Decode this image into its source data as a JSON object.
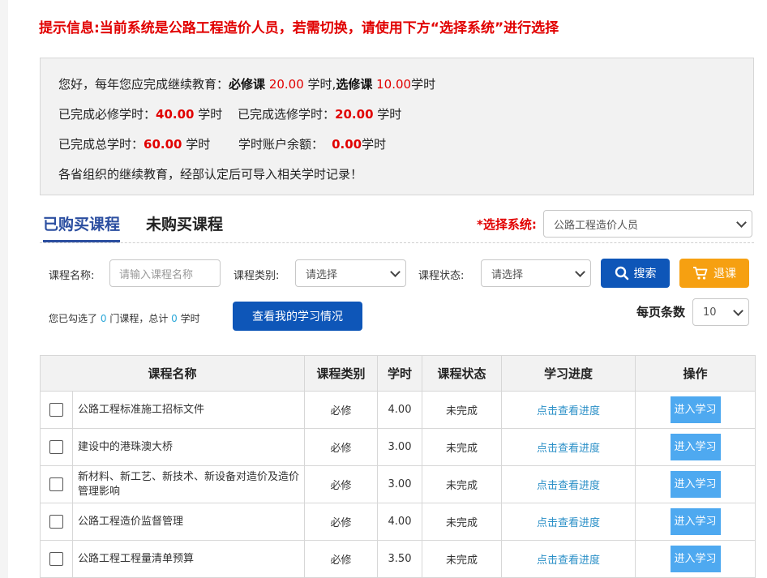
{
  "notice": "提示信息:当前系统是公路工程造价人员，若需切换，请使用下方“选择系统”进行选择",
  "info": {
    "line1_pre": "您好，每年您应完成继续教育：",
    "required_label": "必修课",
    "required_hours": "20.00",
    "unit1": "学时,",
    "elective_label": "选修课",
    "elective_hours": "10.00",
    "unit2": "学时",
    "done_required_label": "已完成必修学时：",
    "done_required_value": "40.00",
    "done_required_unit": "学时",
    "done_elective_label": "已完成选修学时：",
    "done_elective_value": "20.00",
    "done_elective_unit": "学时",
    "done_total_label": "已完成总学时：",
    "done_total_value": "60.00",
    "done_total_unit": "学时",
    "balance_label": "学时账户余额：",
    "balance_value": "0.00",
    "balance_unit": "学时",
    "note": "各省组织的继续教育，经部认定后可导入相关学时记录！"
  },
  "tabs": {
    "purchased": "已购买课程",
    "not_purchased": "未购买课程"
  },
  "system_select": {
    "label": "*选择系统:",
    "value": "公路工程造价人员"
  },
  "filters": {
    "name_label": "课程名称:",
    "name_placeholder": "请输入课程名称",
    "type_label": "课程类别:",
    "type_value": "请选择",
    "status_label": "课程状态:",
    "status_value": "请选择",
    "search_button": "搜索",
    "quit_button": "退课"
  },
  "selection": {
    "pre": "您已勾选了",
    "count": "0",
    "mid": "门课程，总计",
    "hours": "0",
    "post": "学时"
  },
  "study_button": "查看我的学习情况",
  "per_page": {
    "label": "每页条数",
    "value": "10"
  },
  "table": {
    "headers": [
      "课程名称",
      "课程类别",
      "学时",
      "课程状态",
      "学习进度",
      "操作"
    ],
    "rows": [
      {
        "name": "公路工程标准施工招标文件",
        "type": "必修",
        "hours": "4.00",
        "status": "未完成",
        "progress": "点击查看进度",
        "action": "进入学习"
      },
      {
        "name": "建设中的港珠澳大桥",
        "type": "必修",
        "hours": "3.00",
        "status": "未完成",
        "progress": "点击查看进度",
        "action": "进入学习"
      },
      {
        "name": "新材料、新工艺、新技术、新设备对造价及造价管理影响",
        "type": "必修",
        "hours": "3.00",
        "status": "未完成",
        "progress": "点击查看进度",
        "action": "进入学习"
      },
      {
        "name": "公路工程造价监督管理",
        "type": "必修",
        "hours": "4.00",
        "status": "未完成",
        "progress": "点击查看进度",
        "action": "进入学习"
      },
      {
        "name": "公路工程工程量清单预算",
        "type": "必修",
        "hours": "3.50",
        "status": "未完成",
        "progress": "点击查看进度",
        "action": "进入学习"
      }
    ]
  }
}
